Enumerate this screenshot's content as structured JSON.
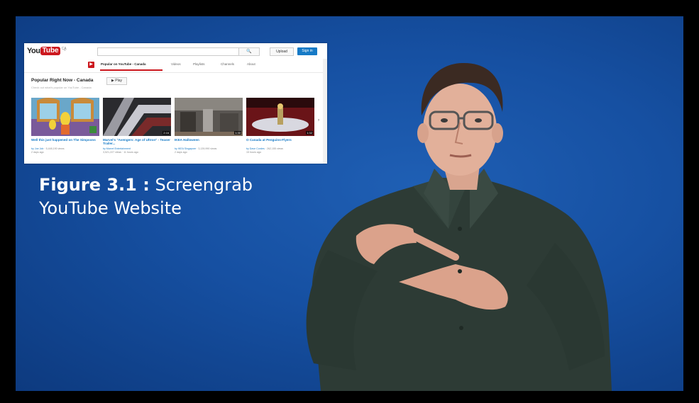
{
  "caption": {
    "figure_label": "Figure 3.1 :",
    "line1_rest": " Screengrab",
    "line2": "YouTube Website"
  },
  "screengrab": {
    "logo_you": "You",
    "logo_tube": "Tube",
    "logo_region": "CA",
    "guide_label": "≡",
    "search_button_icon": "search-icon",
    "search_button": "🔍",
    "upload_button": "Upload",
    "signin_button": "Sign in",
    "tabs": [
      {
        "label": "Popular on YouTube - Canada",
        "active": true
      },
      {
        "label": "Videos",
        "active": false
      },
      {
        "label": "Playlists",
        "active": false
      },
      {
        "label": "Channels",
        "active": false
      },
      {
        "label": "About",
        "active": false
      }
    ],
    "section_title": "Popular Right Now - Canada",
    "play_button": "▶ Play",
    "section_subtitle": "Check out what's popular on YouTube - Canada",
    "next_arrow": "›",
    "videos": [
      {
        "title": "Well this just happened on The Simpsons",
        "channel": "by Joe Job",
        "views": "5,448,190 views",
        "age": "2 days ago",
        "duration": ""
      },
      {
        "title": "Marvel's \"Avengers: Age of Ultron\" - Teaser Trailer...",
        "channel": "by Marvel Entertainment",
        "views": "3,521,227 views",
        "age": "11 hours ago",
        "duration": "2:16"
      },
      {
        "title": "IKEA Halloween",
        "channel": "by IKEA Singapore",
        "views": "3,139,990 views",
        "age": "2 days ago",
        "duration": "1:30"
      },
      {
        "title": "O Canada at Penguins-Flyers",
        "channel": "by Dave Cordes",
        "views": "262,155 views",
        "age": "15 hours ago",
        "duration": "1:32"
      }
    ]
  },
  "colors": {
    "background_blue": "#1650a2",
    "youtube_red": "#cc181e",
    "link_blue": "#167ac6"
  }
}
